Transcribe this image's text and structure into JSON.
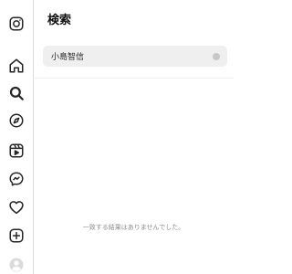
{
  "nav": {
    "icons": [
      {
        "name": "instagram-icon",
        "label": "Instagram"
      },
      {
        "name": "home-icon",
        "label": "Home"
      },
      {
        "name": "search-icon",
        "label": "Search"
      },
      {
        "name": "explore-icon",
        "label": "Explore"
      },
      {
        "name": "reels-icon",
        "label": "Reels"
      },
      {
        "name": "messenger-icon",
        "label": "Messages"
      },
      {
        "name": "heart-icon",
        "label": "Notifications"
      },
      {
        "name": "create-icon",
        "label": "Create"
      },
      {
        "name": "profile-avatar-icon",
        "label": "Profile"
      }
    ]
  },
  "search_panel": {
    "title": "検索",
    "query": "小島智信",
    "empty_message": "一致する結果はありませんでした。"
  },
  "colors": {
    "border": "#dbdbdb",
    "search_bg": "#efefef",
    "muted_text": "#8e8e8e",
    "text": "#111111"
  }
}
